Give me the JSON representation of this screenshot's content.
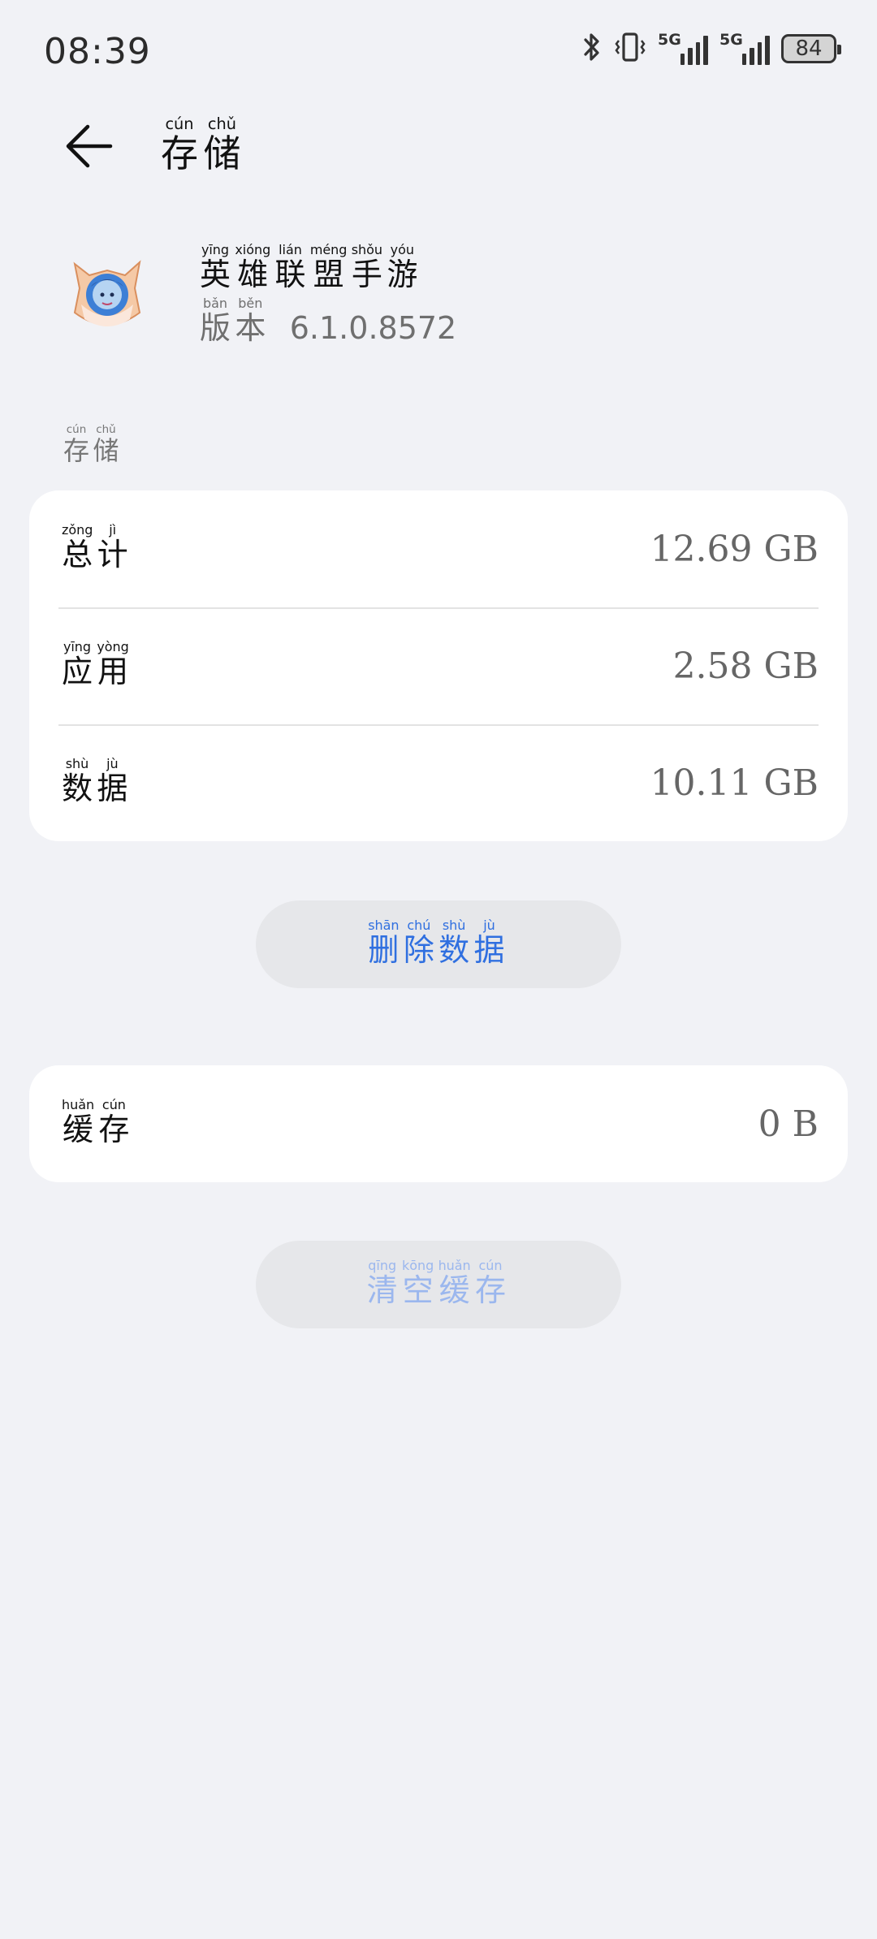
{
  "status_bar": {
    "time": "08:39",
    "network_1": "5G",
    "network_2": "5G",
    "battery": "84",
    "icons": [
      "bluetooth-icon",
      "vibrate-icon",
      "signal-icon",
      "signal-icon",
      "battery-icon"
    ]
  },
  "header": {
    "title": "存储",
    "title_pinyin": [
      "cún",
      "chǔ"
    ]
  },
  "app": {
    "name": "英雄联盟手游",
    "name_pinyin": [
      "yīng",
      "xióng",
      "lián",
      "méng",
      "shǒu",
      "yóu"
    ],
    "version_label": "版本",
    "version_label_pinyin": [
      "bǎn",
      "běn"
    ],
    "version": "6.1.0.8572"
  },
  "storage_section": {
    "label": "存储",
    "label_pinyin": [
      "cún",
      "chǔ"
    ],
    "rows": [
      {
        "label": "总计",
        "pinyin": [
          "zǒng",
          "jì"
        ],
        "value": "12.69 GB"
      },
      {
        "label": "应用",
        "pinyin": [
          "yīng",
          "yòng"
        ],
        "value": "2.58 GB"
      },
      {
        "label": "数据",
        "pinyin": [
          "shù",
          "jù"
        ],
        "value": "10.11 GB"
      }
    ]
  },
  "delete_button": {
    "label": "删除数据",
    "pinyin": [
      "shān",
      "chú",
      "shù",
      "jù"
    ]
  },
  "cache": {
    "label": "缓存",
    "pinyin": [
      "huǎn",
      "cún"
    ],
    "value": "0 B"
  },
  "clear_cache_button": {
    "label": "清空缓存",
    "pinyin": [
      "qīng",
      "kōng",
      "huǎn",
      "cún"
    ],
    "enabled": false
  },
  "colors": {
    "background": "#f1f2f6",
    "card": "#ffffff",
    "accent": "#2f6fe0",
    "accent_disabled": "#9bb7ee",
    "button_bg": "#e6e7ea"
  }
}
